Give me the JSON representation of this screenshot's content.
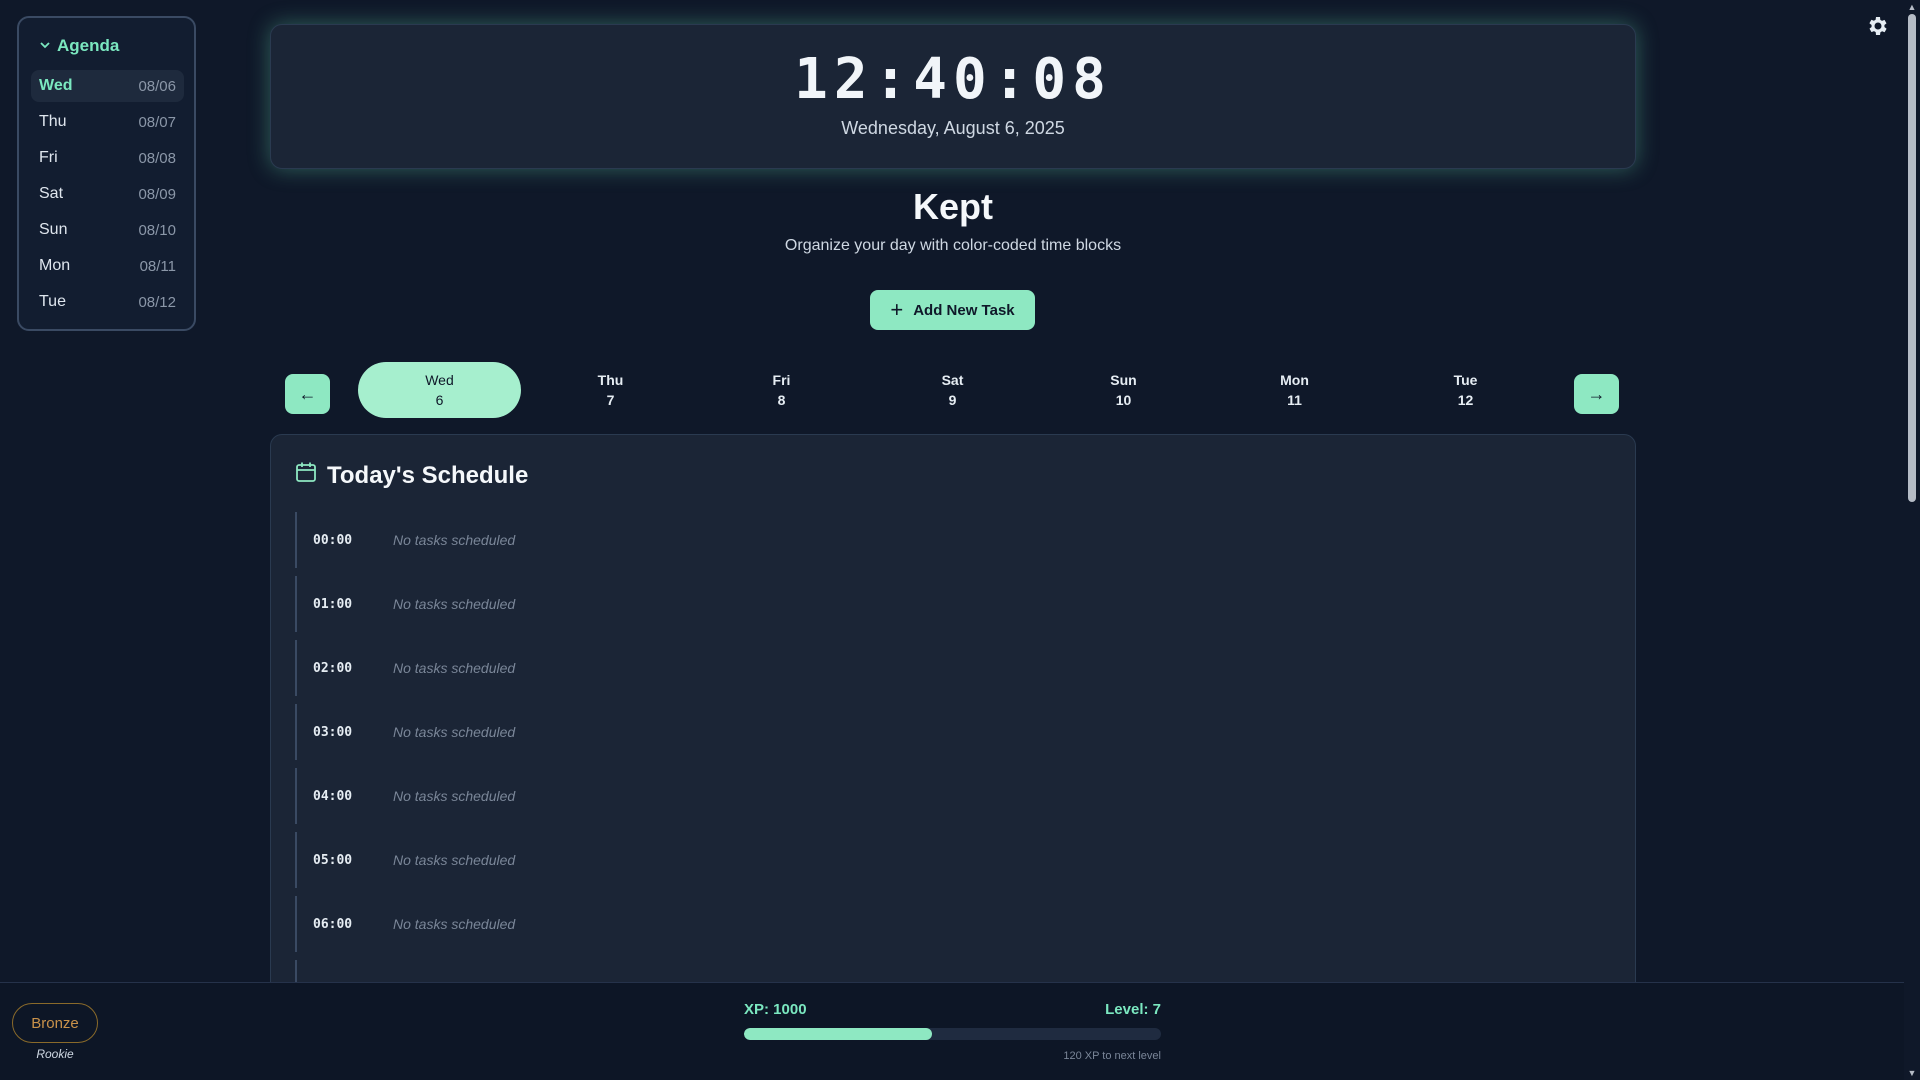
{
  "agenda": {
    "title": "Agenda",
    "items": [
      {
        "day": "Wed",
        "date": "08/06",
        "active": true
      },
      {
        "day": "Thu",
        "date": "08/07"
      },
      {
        "day": "Fri",
        "date": "08/08"
      },
      {
        "day": "Sat",
        "date": "08/09"
      },
      {
        "day": "Sun",
        "date": "08/10"
      },
      {
        "day": "Mon",
        "date": "08/11"
      },
      {
        "day": "Tue",
        "date": "08/12"
      }
    ]
  },
  "clock": {
    "time": "12:40:08",
    "date": "Wednesday, August 6, 2025"
  },
  "app": {
    "title": "Kept",
    "subtitle": "Organize your day with color-coded time blocks"
  },
  "add_task": {
    "label": "Add New Task"
  },
  "day_nav": {
    "prev": "←",
    "next": "→",
    "days": [
      {
        "day": "Wed",
        "num": "6",
        "active": true
      },
      {
        "day": "Thu",
        "num": "7"
      },
      {
        "day": "Fri",
        "num": "8"
      },
      {
        "day": "Sat",
        "num": "9"
      },
      {
        "day": "Sun",
        "num": "10"
      },
      {
        "day": "Mon",
        "num": "11"
      },
      {
        "day": "Tue",
        "num": "12"
      }
    ]
  },
  "schedule": {
    "title": "Today's Schedule",
    "empty_text": "No tasks scheduled",
    "slots": [
      "00:00",
      "01:00",
      "02:00",
      "03:00",
      "04:00",
      "05:00",
      "06:00"
    ]
  },
  "rank": {
    "badge": "Bronze",
    "title": "Rookie"
  },
  "xp": {
    "label": "XP: 1000",
    "level": "Level: 7",
    "progress_percent": 45,
    "next": "120 XP to next level"
  },
  "colors": {
    "accent": "#8ee8c2",
    "accent_text": "#7be8c0",
    "background": "#0f1829",
    "card": "#1b2536",
    "bronze": "#c9924a"
  },
  "icons": {
    "settings": "gear-icon",
    "calendar": "calendar-icon",
    "add": "plus-icon",
    "collapse": "chevron-down-icon"
  }
}
